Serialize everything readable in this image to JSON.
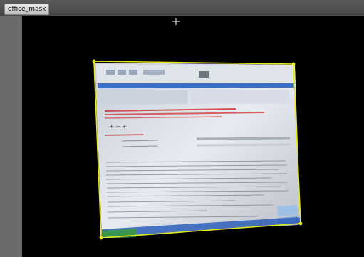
{
  "layer_tab": {
    "label": "office_mask"
  },
  "colors": {
    "mask_outline": "#e6e61a",
    "viewer_background": "#000000",
    "toolbar": "#4a4a4a",
    "side_strip": "#6b6b6b",
    "screen_highlight": "#e8ecf2",
    "page_red_text": "#d02828",
    "page_blue_bar": "#3a6fc8"
  },
  "icons": {
    "cursor": "crosshair-cursor-icon",
    "vertex": "mask-vertex-handle"
  }
}
